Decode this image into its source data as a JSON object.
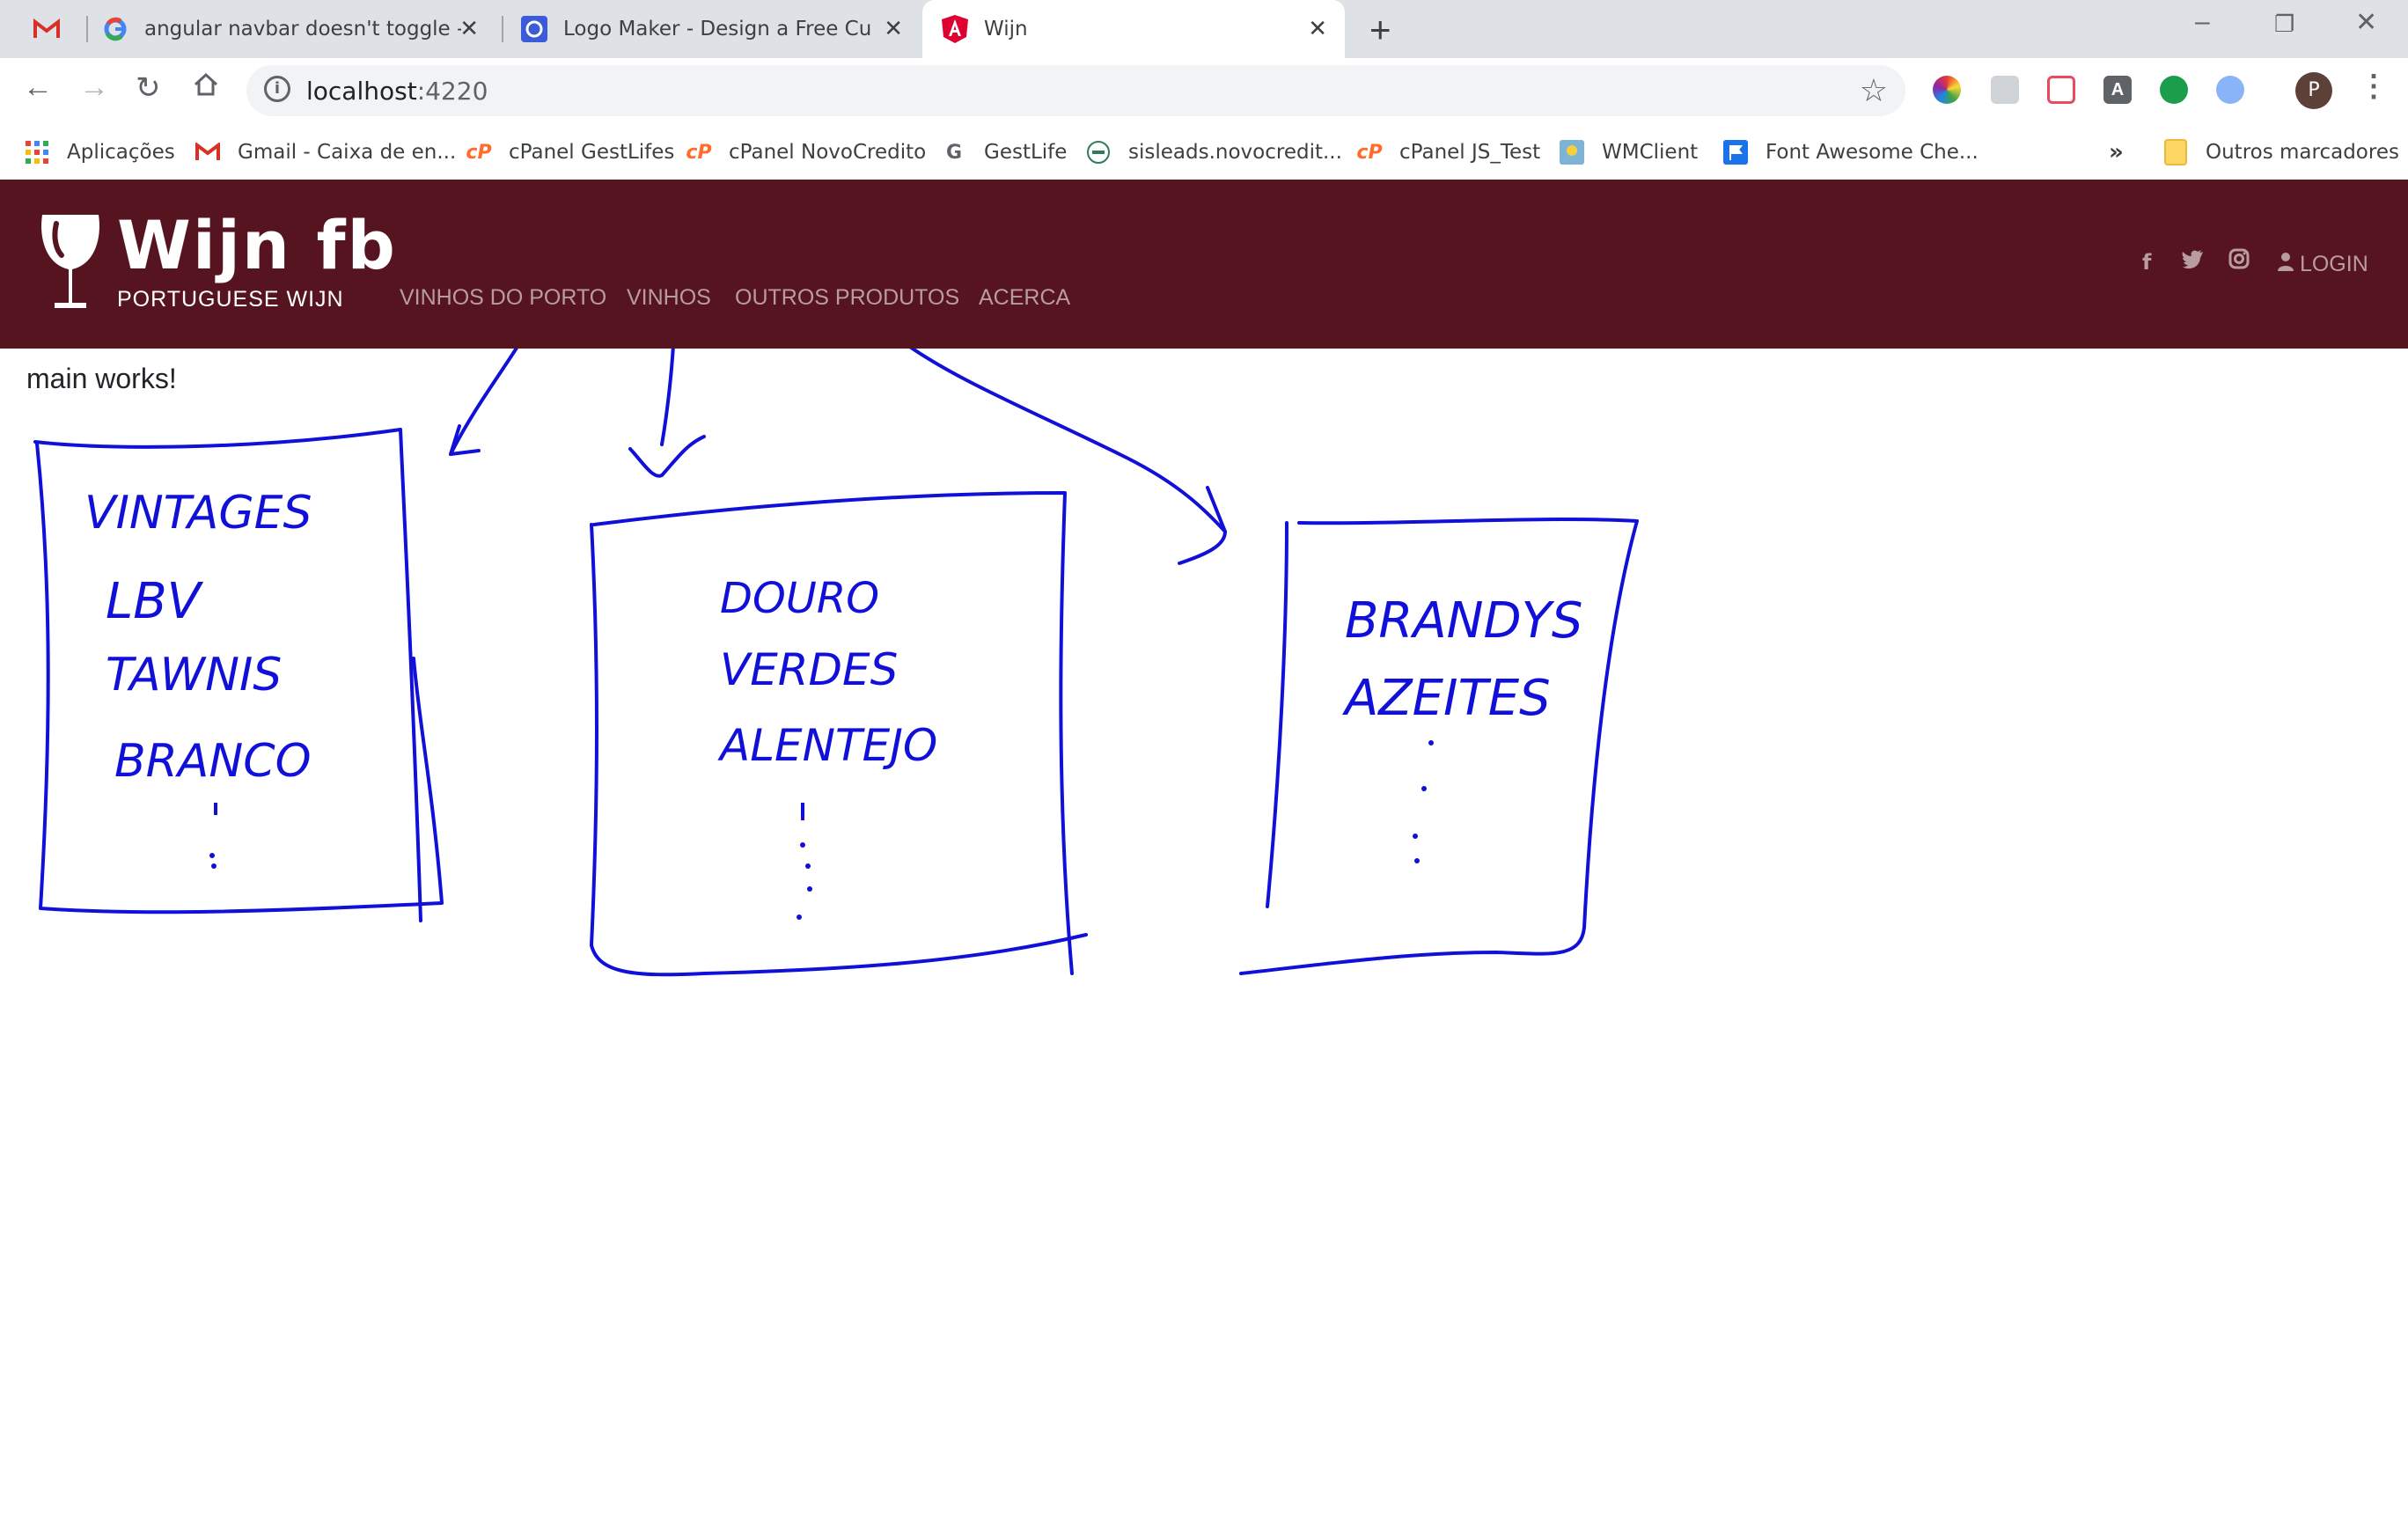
{
  "tabs": [
    {
      "title": "angular navbar doesn't toggle - ",
      "icon": "google-icon"
    },
    {
      "title": "Logo Maker - Design a Free Cust",
      "icon": "logo-maker-icon"
    },
    {
      "title": "Wijn",
      "icon": "angular-icon"
    }
  ],
  "omnibox": {
    "host": "localhost",
    "port": ":4220"
  },
  "bookmarks": [
    {
      "label": "Aplicações",
      "icon": "apps-grid-icon"
    },
    {
      "label": "Gmail - Caixa de en...",
      "icon": "gmail-icon"
    },
    {
      "label": "cPanel GestLifes",
      "icon": "cpanel-icon"
    },
    {
      "label": "cPanel NovoCredito",
      "icon": "cpanel-icon"
    },
    {
      "label": "GestLife",
      "icon": "gestlife-icon"
    },
    {
      "label": "sisleads.novocredit...",
      "icon": "sisleads-icon"
    },
    {
      "label": "cPanel JS_Test",
      "icon": "cpanel-icon"
    },
    {
      "label": "WMClient",
      "icon": "wmclient-icon"
    },
    {
      "label": "Font Awesome Che...",
      "icon": "flag-icon"
    },
    {
      "label": "»",
      "icon": ""
    },
    {
      "label": "Outros marcadores",
      "icon": "folder-icon"
    }
  ],
  "profile_initial": "P",
  "navbar": {
    "brand_title": "Wijn fb",
    "brand_subtitle": "PORTUGUESE WIJN",
    "links": [
      "VINHOS DO PORTO",
      "VINHOS",
      "OUTROS PRODUTOS",
      "ACERCA"
    ],
    "login_label": "LOGIN",
    "social_icons": [
      "facebook-icon",
      "twitter-icon",
      "instagram-icon"
    ],
    "brand_color": "#561420"
  },
  "main_text": "main works!",
  "sketch": {
    "color": "#1010d8",
    "box1": [
      "VINTAGES",
      "LBV",
      "TAWNIS",
      "BRANCO"
    ],
    "box2": [
      "DOURO",
      "VERDES",
      "ALENTEJO"
    ],
    "box3": [
      "BRANDYS",
      "AZEITES"
    ]
  }
}
